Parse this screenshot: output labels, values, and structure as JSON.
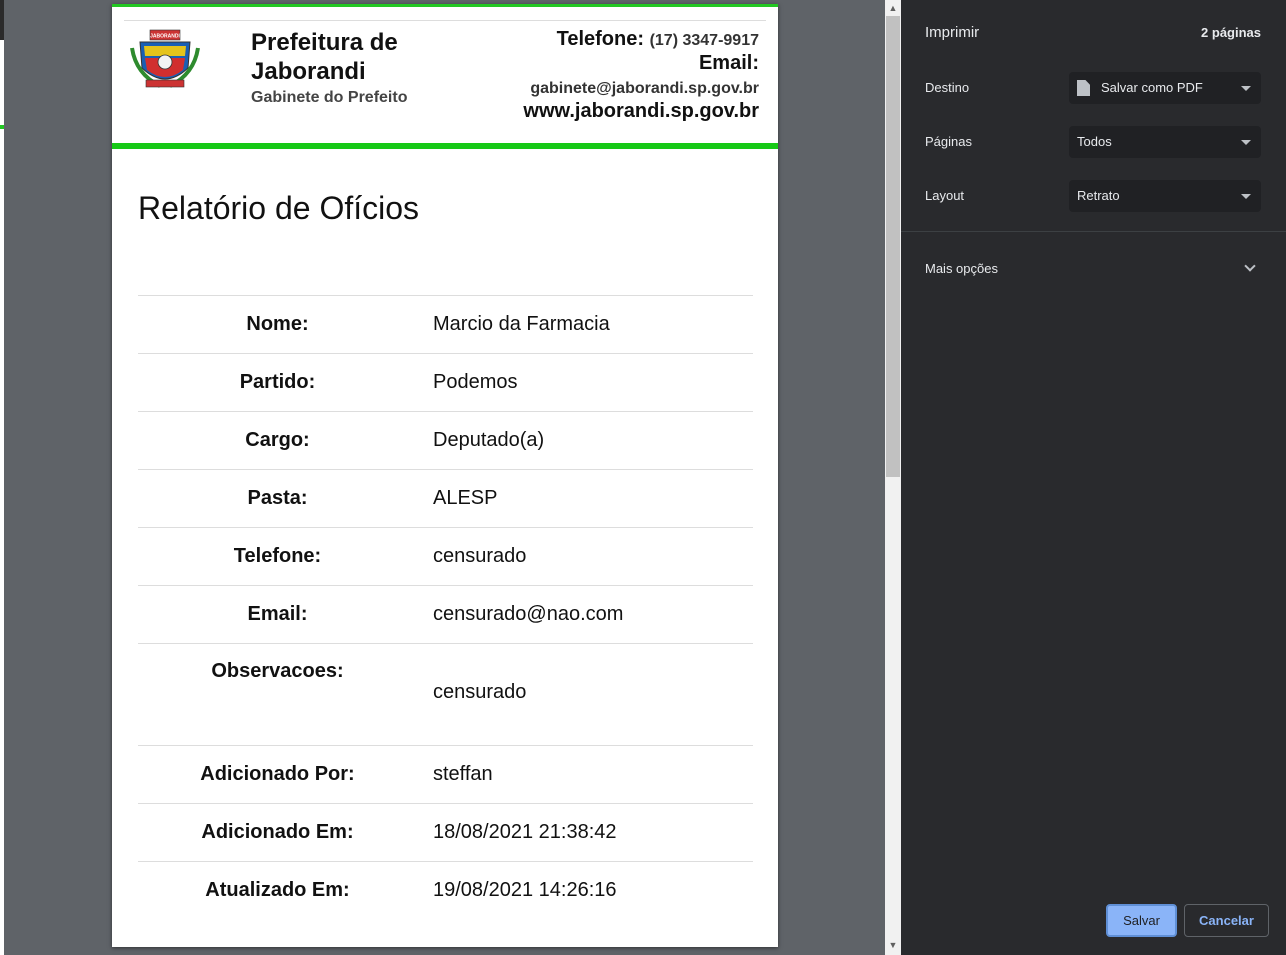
{
  "document": {
    "header": {
      "org_name": "Prefeitura de Jaborandi",
      "org_subtitle": "Gabinete do Prefeito",
      "phone_label": "Telefone:",
      "phone_value": "(17) 3347-9917",
      "email_label": "Email:",
      "email_value": "gabinete@jaborandi.sp.gov.br",
      "website": "www.jaborandi.sp.gov.br",
      "crest_banner": "JABORANDI"
    },
    "title": "Relatório de Ofícios",
    "rows": [
      {
        "label": "Nome:",
        "value": "Marcio da Farmacia"
      },
      {
        "label": "Partido:",
        "value": "Podemos"
      },
      {
        "label": "Cargo:",
        "value": "Deputado(a)"
      },
      {
        "label": "Pasta:",
        "value": "ALESP"
      },
      {
        "label": "Telefone:",
        "value": "censurado"
      },
      {
        "label": "Email:",
        "value": "censurado@nao.com"
      },
      {
        "label": "Observacoes:",
        "value": "censurado"
      },
      {
        "label": "Adicionado Por:",
        "value": "steffan"
      },
      {
        "label": "Adicionado Em:",
        "value": "18/08/2021 21:38:42"
      },
      {
        "label": "Atualizado Em:",
        "value": "19/08/2021 14:26:16"
      }
    ]
  },
  "print_panel": {
    "title": "Imprimir",
    "page_count": "2 páginas",
    "destination_label": "Destino",
    "destination_value": "Salvar como PDF",
    "destination_icon": "file-icon",
    "pages_label": "Páginas",
    "pages_value": "Todos",
    "layout_label": "Layout",
    "layout_value": "Retrato",
    "more_options_label": "Mais opções",
    "save_label": "Salvar",
    "cancel_label": "Cancelar"
  },
  "colors": {
    "accent_green": "#16c916",
    "panel_bg": "#292a2d",
    "preview_bg": "#5f6368",
    "button_blue": "#8ab4f8"
  }
}
